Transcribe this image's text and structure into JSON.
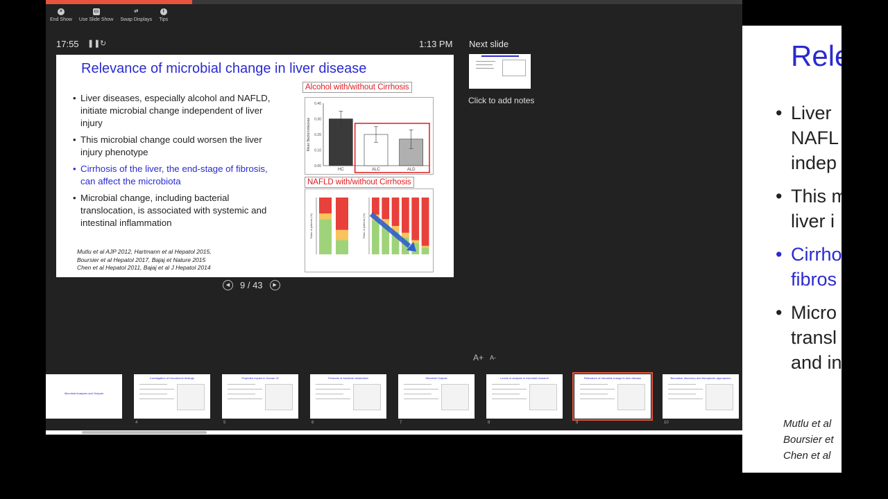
{
  "toolbar": [
    {
      "label": "End Show",
      "icon": "close-icon"
    },
    {
      "label": "Use Slide Show",
      "icon": "screen-icon"
    },
    {
      "label": "Swap Displays",
      "icon": "swap-icon"
    },
    {
      "label": "Tips",
      "icon": "info-icon"
    }
  ],
  "progress": {
    "fraction": 0.21,
    "color": "#e8533b"
  },
  "timer": "17:55",
  "clock": "1:13 PM",
  "next_slide_label": "Next slide",
  "notes_placeholder": "Click to add notes",
  "slide": {
    "title": "Relevance of microbial change in liver disease",
    "bullets": [
      {
        "text": "Liver diseases, especially alcohol and NAFLD, initiate microbial change independent of liver injury",
        "highlight": false
      },
      {
        "text": "This microbial change could worsen the liver injury phenotype",
        "highlight": false
      },
      {
        "text": "Cirrhosis of the liver, the end-stage of fibrosis, can affect the microbiota",
        "highlight": true
      },
      {
        "text": "Microbial change, including bacterial translocation, is associated with systemic and intestinal inflammation",
        "highlight": false
      }
    ],
    "references": [
      "Mutlu et al AJP 2012,  Hartmann et al Hepatol 2015,",
      "Boursier et al Hepatol 2017, Bajaj et Nature 2015",
      "Chen et al Hepatol 2011, Bajaj et al J Hepatol 2014"
    ],
    "chart1_title": "Alcohol with/without Cirrhosis",
    "chart2_title": "NAFLD with/without Cirrhosis"
  },
  "chart_data": [
    {
      "type": "bar",
      "title": "Alcohol with/without Cirrhosis",
      "ylabel": "Mean Bacteroidaceae",
      "categories": [
        "HC",
        "ALC",
        "ALD"
      ],
      "values": [
        0.3,
        0.2,
        0.17
      ],
      "errors": [
        0.05,
        0.05,
        0.06
      ],
      "colors": [
        "#3a3a3a",
        "#ffffff",
        "#b0b0b0"
      ],
      "yticks": [
        "0.00",
        "0.10",
        "0.20",
        "0.30",
        "0.40"
      ],
      "ylim": [
        0,
        0.4
      ]
    },
    {
      "type": "bar",
      "title": "NAFLD with/without Cirrhosis",
      "stacked": true,
      "ylabel": "Ratio of patients (%)",
      "series_colors": [
        "#9fd37a",
        "#f7c45d",
        "#e8403a"
      ],
      "panels": [
        {
          "bars": [
            [
              62,
              10,
              28
            ],
            [
              25,
              18,
              57
            ]
          ]
        },
        {
          "bars": [
            [
              60,
              10,
              30
            ],
            [
              50,
              12,
              38
            ],
            [
              40,
              10,
              50
            ],
            [
              30,
              8,
              62
            ],
            [
              20,
              5,
              75
            ],
            [
              12,
              3,
              85
            ]
          ]
        }
      ]
    }
  ],
  "navigation": {
    "page": "9 / 43",
    "prev_icon": "prev-icon",
    "next_icon": "next-icon"
  },
  "font_controls": {
    "increase": "A+",
    "decrease": "A-"
  },
  "thumbnails": [
    {
      "num": "",
      "caption": "Microbial Analyses and Outputs"
    },
    {
      "num": "4",
      "caption": "Investigation of microbiome findings"
    },
    {
      "num": "5",
      "caption": "Projected impact in Human GI"
    },
    {
      "num": "6",
      "caption": "Products of bacterial metabolism"
    },
    {
      "num": "7",
      "caption": "Microbial Outputs"
    },
    {
      "num": "8",
      "caption": "Levels of analysis in microbial research"
    },
    {
      "num": "9",
      "caption": "Relevance of microbial change in liver disease"
    },
    {
      "num": "10",
      "caption": "Biomarker discovery and therapeutic approaches"
    }
  ],
  "secondary": {
    "title": "Rele",
    "lines": [
      {
        "text": "Liver",
        "bullet": true,
        "highlight": false
      },
      {
        "text": "NAFL",
        "bullet": false,
        "highlight": false
      },
      {
        "text": "indep",
        "bullet": false,
        "highlight": false
      },
      {
        "text": "This m",
        "bullet": true,
        "highlight": false
      },
      {
        "text": "liver i",
        "bullet": false,
        "highlight": false
      },
      {
        "text": "Cirrhos",
        "bullet": true,
        "highlight": true
      },
      {
        "text": "fibros",
        "bullet": false,
        "highlight": true
      },
      {
        "text": "Micro",
        "bullet": true,
        "highlight": false
      },
      {
        "text": "transl",
        "bullet": false,
        "highlight": false
      },
      {
        "text": "and in",
        "bullet": false,
        "highlight": false
      }
    ],
    "refs": [
      "Mutlu et al",
      "Boursier et",
      "Chen et al"
    ]
  }
}
